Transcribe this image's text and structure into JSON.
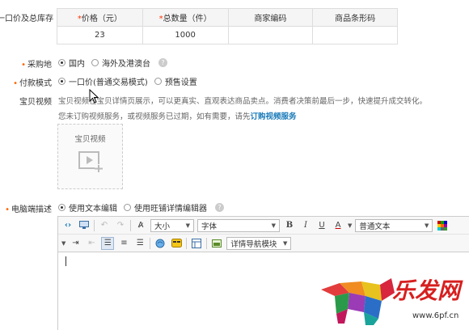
{
  "stock": {
    "label": "一口价及总库存",
    "headers": [
      {
        "star": "*",
        "text": "价格（元）"
      },
      {
        "star": "*",
        "text": "总数量（件）"
      },
      {
        "star": "",
        "text": "商家编码"
      },
      {
        "star": "",
        "text": "商品条形码"
      }
    ],
    "values": [
      "23",
      "1000",
      "",
      ""
    ]
  },
  "purchase": {
    "label": "采购地",
    "options": [
      "国内",
      "海外及港澳台"
    ],
    "selected": 0
  },
  "payment": {
    "label": "付款模式",
    "options": [
      "一口价(普通交易模式)",
      "预售设置"
    ],
    "selected": 0
  },
  "video": {
    "label": "宝贝视频",
    "desc": "宝贝视频在宝贝详情页展示，可以更真实、直观表达商品卖点。消费者决策前最后一步，快速提升成交转化。",
    "notice_prefix": "您未订购视频服务，或视频服务已过期，如有需要，请先",
    "notice_link": "订购视频服务",
    "box_title": "宝贝视频"
  },
  "pc_desc": {
    "label": "电脑端描述",
    "options": [
      "使用文本编辑",
      "使用旺铺详情编辑器"
    ],
    "selected": 0
  },
  "editor": {
    "size_label": "大小",
    "font_label": "字体",
    "format_label": "普通文本",
    "module_label": "详情导航模块"
  },
  "watermark": {
    "brand": "乐发网",
    "url": "www.6pf.cn"
  },
  "colors": {
    "accent": "#1a7bb9",
    "required": "#ff6600",
    "brand": "#d71f1f"
  }
}
